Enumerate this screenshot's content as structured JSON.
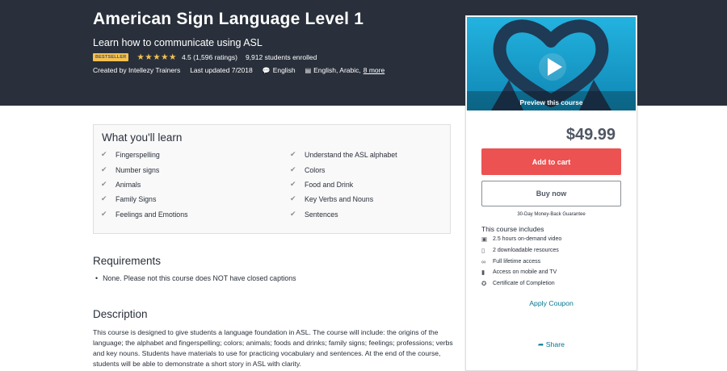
{
  "course": {
    "title": "American Sign Language Level 1",
    "subtitle": "Learn how to communicate using ASL",
    "badge": "BESTSELLER",
    "stars": "★★★★★",
    "rating": "4.5 (1,596 ratings)",
    "rating_value": 4.5,
    "enrolled": "9,912 students enrolled",
    "created_by": "Created by Intellezy Trainers",
    "last_updated": "Last updated 7/2018",
    "language": "English",
    "captions": "English, Arabic,",
    "captions_more": "8 more"
  },
  "learn": {
    "title": "What you'll learn",
    "left_items": [
      "Fingerspelling",
      "Number signs",
      "Animals",
      "Family Signs",
      "Feelings and Emotions"
    ],
    "right_items": [
      "Understand the ASL alphabet",
      "Colors",
      "Food and Drink",
      "Key Verbs and Nouns",
      "Sentences"
    ]
  },
  "requirements": {
    "title": "Requirements",
    "items": [
      "None. Please not this course does NOT have closed captions"
    ]
  },
  "description": {
    "title": "Description",
    "text": "This course is designed to give students a language foundation in ASL. The course will include: the origins of the language; the alphabet and fingerspelling; colors; animals; foods and drinks; family signs; feelings; professions; verbs and key nouns. Students have materials to use for practicing vocabulary and sentences. At the end of the course, students will be able to demonstrate a short story in ASL with clarity."
  },
  "sidebar": {
    "preview_label": "Preview this course",
    "price": "$49.99",
    "add_to_cart": "Add to cart",
    "buy_now": "Buy now",
    "guarantee": "30-Day Money-Back Guarantee",
    "includes_title": "This course includes",
    "includes": [
      {
        "icon": "video-icon",
        "label": "2.5 hours on-demand video"
      },
      {
        "icon": "file-icon",
        "label": "2 downloadable resources"
      },
      {
        "icon": "infinity-icon",
        "label": "Full lifetime access"
      },
      {
        "icon": "mobile-icon",
        "label": "Access on mobile and TV"
      },
      {
        "icon": "certificate-icon",
        "label": "Certificate of Completion"
      }
    ],
    "apply_coupon": "Apply Coupon",
    "share": "Share"
  },
  "colors": {
    "hero_bg": "#29303b",
    "accent_red": "#ec5252",
    "star_gold": "#f4c150",
    "link_teal": "#007791",
    "preview_blue": "#19a6d3"
  }
}
